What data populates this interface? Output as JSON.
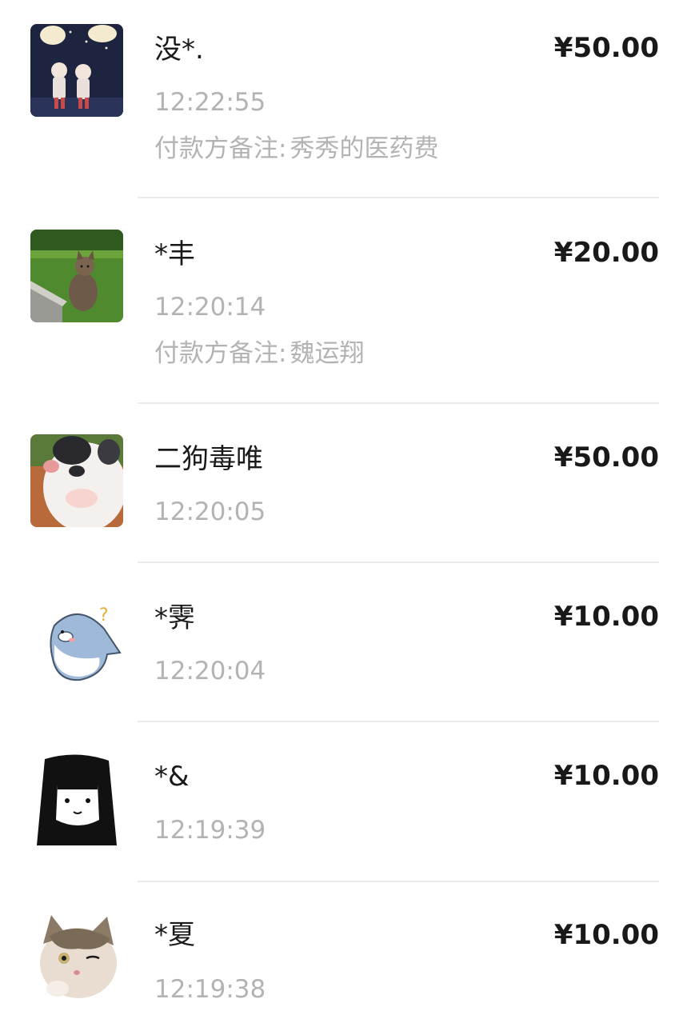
{
  "payments": [
    {
      "avatar_icon": "twins-illustration-avatar",
      "name": "没*.",
      "amount": "¥50.00",
      "time": "12:22:55",
      "note_label": "付款方备注:",
      "note_text": "秀秀的医药费"
    },
    {
      "avatar_icon": "cat-on-grass-avatar",
      "name": "*丰",
      "amount": "¥20.00",
      "time": "12:20:14",
      "note_label": "付款方备注:",
      "note_text": "魏运翔"
    },
    {
      "avatar_icon": "cat-closeup-avatar",
      "name": "二狗毒唯",
      "amount": "¥50.00",
      "time": "12:20:05"
    },
    {
      "avatar_icon": "shark-sticker-avatar",
      "name": "*霁",
      "amount": "¥10.00",
      "time": "12:20:04"
    },
    {
      "avatar_icon": "anime-girl-avatar",
      "name": "*&",
      "amount": "¥10.00",
      "time": "12:19:39"
    },
    {
      "avatar_icon": "winking-cat-avatar",
      "name": "*夏",
      "amount": "¥10.00",
      "time": "12:19:38"
    }
  ]
}
